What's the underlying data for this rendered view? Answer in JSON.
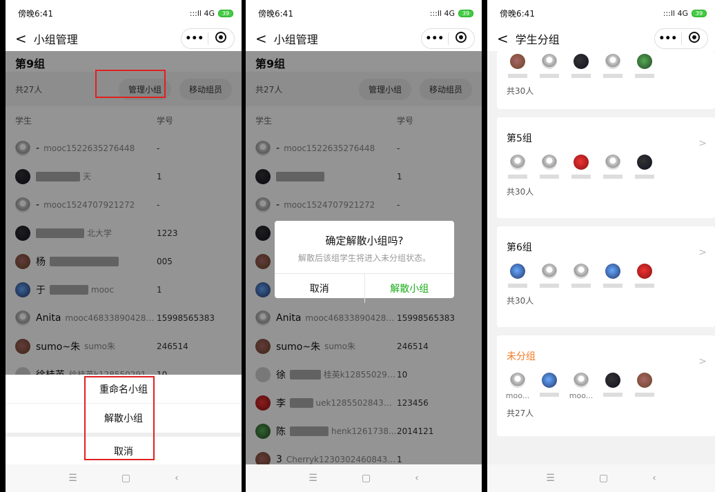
{
  "status": {
    "time": "傍晚6:41",
    "signal": ":::ll 4G",
    "battery": "39"
  },
  "capsule": {
    "more": "•••"
  },
  "icons": {
    "back": "chevron-left-icon",
    "record": "record-icon"
  },
  "panel1": {
    "nav_title": "小组管理",
    "group_title": "第9组",
    "count": "共27人",
    "manage_btn": "管理小组",
    "move_btn": "移动组员",
    "col_student": "学生",
    "col_id": "学号",
    "rows": [
      {
        "name": "-",
        "sub": "mooc1522635276448",
        "id": "-"
      },
      {
        "name": "",
        "sub": "天",
        "id": "1"
      },
      {
        "name": "-",
        "sub": "mooc1524707921272",
        "id": "-"
      },
      {
        "name": "",
        "sub": "北大学",
        "id": "1223"
      },
      {
        "name": "杨",
        "sub": "",
        "id": "005"
      },
      {
        "name": "于",
        "sub": "mooc",
        "id": "1"
      },
      {
        "name": "Anita",
        "sub": "mooc468338904286...",
        "id": "15998565383"
      },
      {
        "name": "sumo~朱",
        "sub": "sumo朱",
        "id": "246514"
      },
      {
        "name": "徐桂英",
        "sub": "徐桂英k1285502913...",
        "id": "10"
      }
    ],
    "sheet": {
      "rename": "重命名小组",
      "dissolve": "解散小组",
      "cancel": "取消"
    }
  },
  "panel2": {
    "nav_title": "小组管理",
    "group_title": "第9组",
    "count": "共27人",
    "manage_btn": "管理小组",
    "move_btn": "移动组员",
    "col_student": "学生",
    "col_id": "学号",
    "rows": [
      {
        "name": "-",
        "sub": "mooc1522635276448",
        "id": "-"
      },
      {
        "name": "",
        "sub": "",
        "id": "1"
      },
      {
        "name": "-",
        "sub": "mooc1524707921272",
        "id": "-"
      },
      {
        "name": "",
        "sub": "",
        "id": ""
      },
      {
        "name": "",
        "sub": "",
        "id": ""
      },
      {
        "name": "",
        "sub": "",
        "id": ""
      },
      {
        "name": "Anita",
        "sub": "mooc468338904286...",
        "id": "15998565383"
      },
      {
        "name": "sumo~朱",
        "sub": "sumo朱",
        "id": "246514"
      },
      {
        "name": "徐",
        "sub": "桂英k1285502913...",
        "id": "10"
      },
      {
        "name": "李",
        "sub": "uek12855028431231...",
        "id": "123456"
      },
      {
        "name": "陈",
        "sub": "henk1261738...",
        "id": "2014121"
      },
      {
        "name": "3",
        "sub": "Cherryk12303024608436...",
        "id": "1"
      }
    ],
    "dialog": {
      "title": "确定解散小组吗?",
      "message": "解散后该组学生将进入未分组状态。",
      "cancel": "取消",
      "confirm": "解散小组"
    }
  },
  "panel3": {
    "nav_title": "学生分组",
    "top_count": "共30人",
    "groups": [
      {
        "title": "第5组",
        "count": "共30人",
        "labels": [
          "",
          "",
          "",
          "",
          ""
        ]
      },
      {
        "title": "第6组",
        "count": "共30人",
        "labels": [
          "",
          "",
          "",
          "",
          ""
        ]
      },
      {
        "title": "未分组",
        "count": "共27人",
        "labels": [
          "moo...",
          "",
          "moo...",
          "",
          ""
        ]
      }
    ]
  },
  "nav_buttons": {
    "menu": "☰",
    "home": "▢",
    "back": "‹"
  },
  "colors": {
    "accent_green": "#1aad19",
    "accent_orange": "#f57a22",
    "highlight_red": "#e02020"
  }
}
